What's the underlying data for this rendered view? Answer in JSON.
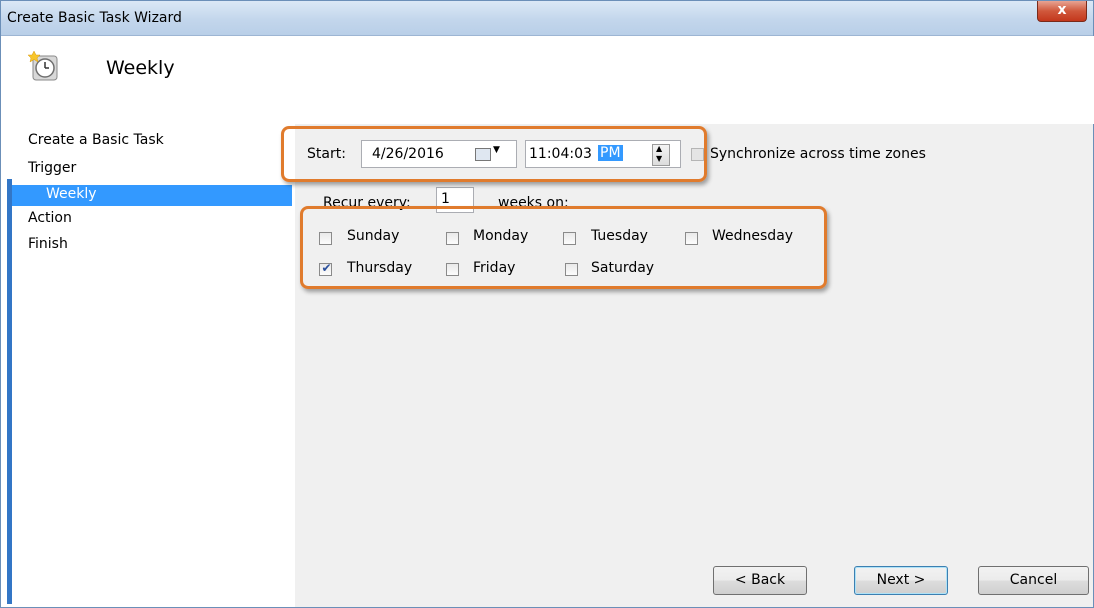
{
  "window": {
    "title": "Create Basic Task Wizard",
    "close_label": "x"
  },
  "header": {
    "title": "Weekly"
  },
  "nav": {
    "items": [
      "Create a Basic Task",
      "Trigger",
      "Weekly",
      "Action",
      "Finish"
    ],
    "selected": "Weekly"
  },
  "trigger": {
    "start_label": "Start:",
    "date": "4/26/2016",
    "time": "11:04:03",
    "time_ampm": "PM",
    "sync_label": "Synchronize across time zones",
    "sync_checked": false,
    "recur_label": "Recur every:",
    "recur_value": "1",
    "recur_suffix": "weeks on:"
  },
  "days": [
    {
      "label": "Sunday",
      "checked": false
    },
    {
      "label": "Monday",
      "checked": false
    },
    {
      "label": "Tuesday",
      "checked": false
    },
    {
      "label": "Wednesday",
      "checked": false
    },
    {
      "label": "Thursday",
      "checked": true
    },
    {
      "label": "Friday",
      "checked": false
    },
    {
      "label": "Saturday",
      "checked": false
    }
  ],
  "buttons": {
    "back": "< Back",
    "next": "Next >",
    "cancel": "Cancel"
  },
  "colors": {
    "highlight": "#e07b2d",
    "selection": "#3399ff",
    "content_bg": "#f0f0f0"
  }
}
